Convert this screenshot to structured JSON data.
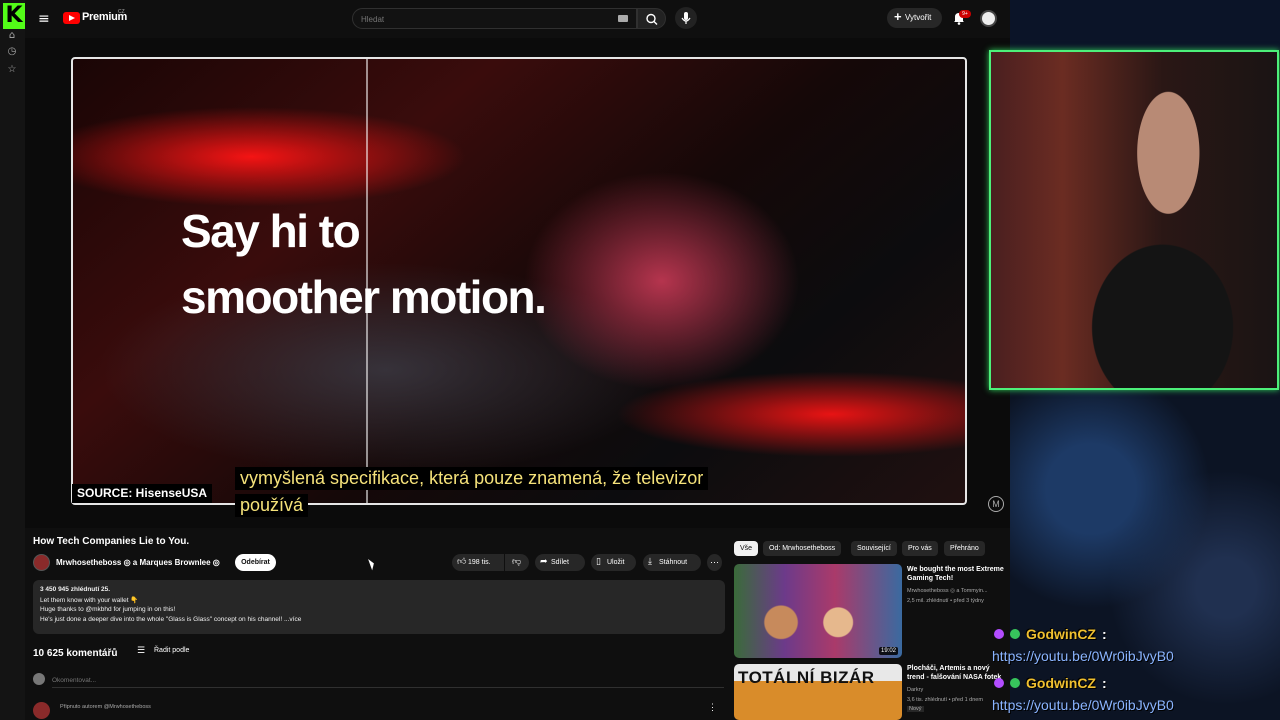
{
  "kick": {
    "logo": "K"
  },
  "header": {
    "brand": "Premium",
    "region": "CZ",
    "search_placeholder": "Hledat",
    "create_label": "Vytvořit",
    "notification_count": "9+"
  },
  "video": {
    "headline_line1": "Say hi to",
    "headline_line2": "smoother motion.",
    "source_label": "SOURCE: HisenseUSA",
    "subtitle_line1": "vymyšlená specifikace, která pouze znamená, že televizor",
    "subtitle_line2": "používá",
    "title": "How Tech Companies Lie to You.",
    "channel_names": "Mrwhosetheboss ◎ a Marques Brownlee ◎",
    "subscribe_label": "Odebírat",
    "actions": {
      "likes": "198 tis.",
      "share": "Sdílet",
      "save": "Uložit",
      "download": "Stáhnout"
    }
  },
  "description": {
    "lines": [
      "3 450 945 zhlédnutí  25.",
      "Let them know with your wallet 👇",
      "Huge thanks to @mkbhd for jumping in on this!",
      "He's just done a deeper dive into the whole \"Glass is Glass\" concept on his channel!   ...více"
    ]
  },
  "comments": {
    "count": "10 625 komentářů",
    "sort_label": "Řadit podle",
    "input_placeholder": "Okomentovat...",
    "pinned_note": "Připnuto autorem @Mrwhosetheboss"
  },
  "chips": [
    "Vše",
    "Od: Mrwhosetheboss",
    "Související",
    "Pro vás",
    "Přehráno"
  ],
  "recommendations": [
    {
      "title": "We bought the most Extreme Gaming Tech!",
      "channel": "Mrwhosetheboss ◎ a Tommyin...",
      "meta": "2,5 mil. zhlédnutí • před 3 týdny",
      "duration": "19:02"
    },
    {
      "thumb_text": "TOTÁLNÍ BIZÁR",
      "title": "Plocháči, Artemis a nový trend - falšování NASA fotek",
      "channel": "Darkry",
      "meta": "3,6 tis. zhlédnutí • před 1 dnem",
      "badge": "Nový"
    }
  ],
  "chat": [
    {
      "user": "GodwinCZ",
      "message": "https://youtu.be/0Wr0ibJvyB0"
    },
    {
      "user": "GodwinCZ",
      "message": "https://youtu.be/0Wr0ibJvyB0"
    }
  ],
  "colors": {
    "kick_green": "#53fc18",
    "yt_red": "#ff0000",
    "webcam_border": "#4df07a",
    "chat_user": "#f0c030",
    "chat_link": "#8ab4ff"
  }
}
